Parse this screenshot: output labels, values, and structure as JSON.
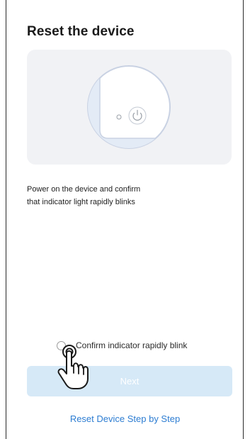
{
  "screen": {
    "title": "Reset the device",
    "instructions": {
      "line1": "Power on the device and confirm",
      "line2": "that indicator light rapidly blinks"
    },
    "confirm": {
      "label": "Confirm indicator rapidly blink",
      "checked": false
    },
    "next_button": {
      "label": "Next",
      "enabled": false
    },
    "reset_link": "Reset Device Step by Step"
  },
  "icons": {
    "device_illustration": "device-power-illustration",
    "power": "power-icon",
    "indicator": "indicator-light-icon",
    "tap_hand": "tap-hand-icon",
    "radio": "radio-unchecked-icon"
  },
  "colors": {
    "link": "#2d7dd2",
    "button_disabled_bg": "#d6e9f7",
    "illustration_bg": "#f1f2f5",
    "title": "#1a1a1a"
  }
}
